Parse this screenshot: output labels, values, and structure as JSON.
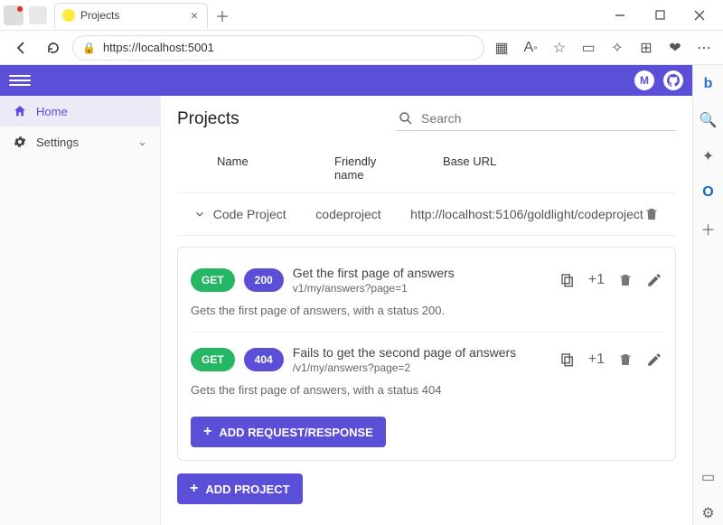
{
  "browser": {
    "tab_title": "Projects",
    "url": "https://localhost:5001"
  },
  "appbar": {
    "brand_letter": "M"
  },
  "sidenav": {
    "home": "Home",
    "settings": "Settings"
  },
  "page": {
    "title": "Projects",
    "search_placeholder": "Search"
  },
  "table": {
    "headers": {
      "name": "Name",
      "friendly_name": "Friendly\nname",
      "base_url": "Base URL"
    },
    "project": {
      "name": "Code Project",
      "friendly_name": "codeproject",
      "base_url": "http://localhost:5106/goldlight/codeproject"
    }
  },
  "rr": [
    {
      "method": "GET",
      "status": "200",
      "title": "Get the first page of answers",
      "path": "v1/my/answers?page=1",
      "desc": "Gets the first page of answers, with a status 200.",
      "plus_label": "+1"
    },
    {
      "method": "GET",
      "status": "404",
      "title": "Fails to get the second page of answers",
      "path": "/v1/my/answers?page=2",
      "desc": "Gets the first page of answers, with a status 404",
      "plus_label": "+1"
    }
  ],
  "buttons": {
    "add_rr": "ADD REQUEST/RESPONSE",
    "add_project": "ADD PROJECT"
  }
}
